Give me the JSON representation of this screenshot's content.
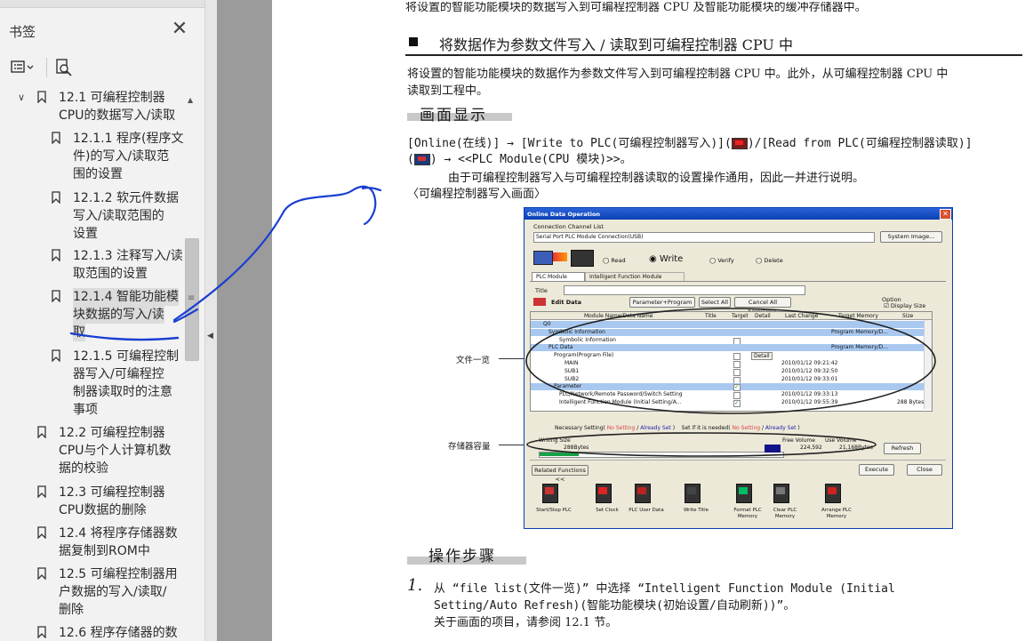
{
  "sidebar": {
    "title": "书签",
    "close_icon": "close-icon",
    "tools": {
      "options_icon": "list-options-icon",
      "search_icon": "bookmark-search-icon"
    },
    "items": [
      {
        "label_lines": [
          "12.1 可编程控制器",
          "CPU的数据写入/读取"
        ],
        "level": 1,
        "expanded": true
      },
      {
        "label_lines": [
          "12.1.1 程序(程序文",
          "件)的写入/读取范",
          "围的设置"
        ],
        "level": 2
      },
      {
        "label_lines": [
          "12.1.2 软元件数据",
          "写入/读取范围的",
          "设置"
        ],
        "level": 2
      },
      {
        "label_lines": [
          "12.1.3 注释写入/读",
          "取范围的设置"
        ],
        "level": 2
      },
      {
        "label_lines": [
          "12.1.4 智能功能模",
          "块数据的写入/读",
          "取"
        ],
        "level": 2,
        "selected": true
      },
      {
        "label_lines": [
          "12.1.5 可编程控制",
          "器写入/可编程控",
          "制器读取时的注意",
          "事项"
        ],
        "level": 2
      },
      {
        "label_lines": [
          "12.2 可编程控制器",
          "CPU与个人计算机数",
          "据的校验"
        ],
        "level": 1
      },
      {
        "label_lines": [
          "12.3 可编程控制器",
          "CPU数据的删除"
        ],
        "level": 1
      },
      {
        "label_lines": [
          "12.4 将程序存储器数",
          "据复制到ROM中"
        ],
        "level": 1
      },
      {
        "label_lines": [
          "12.5 可编程控制器用",
          "户数据的写入/读取/",
          "删除"
        ],
        "level": 1
      },
      {
        "label_lines": [
          "12.6 程序存储器的数"
        ],
        "level": 1
      }
    ]
  },
  "page": {
    "top_cut_line": "将设置的智能功能模块的数据写入到可编程控制器 CPU 及智能功能模块的缓冲存储器中。",
    "section_heading": "将数据作为参数文件写入 / 读取到可编程控制器 CPU 中",
    "para_line1": "将设置的智能功能模块的数据作为参数文件写入到可编程控制器 CPU 中。此外，从可编程控制器 CPU 中",
    "para_line2": "读取到工程中。",
    "screen_heading": "画面显示",
    "online_line1_a": "[Online(在线)] → [Write to PLC(可编程控制器写入)](",
    "online_line1_b": ")/[Read from PLC(可编程控制器读取)]",
    "online_line2_a": "(",
    "online_line2_b": ") → <<PLC Module(CPU 模块)>>。",
    "common_note": "由于可编程控制器写入与可编程控制器读取的设置操作通用，因此一并进行说明。",
    "write_screen_label": "〈可编程控制器写入画面〉",
    "label_file_list": "文件一览",
    "label_storage": "存储器容量",
    "steps_heading": "操作步骤",
    "step_num": "1.",
    "step_line1": "从 “file list(文件一览)” 中选择 “Intelligent Function Module (Initial",
    "step_line2": "Setting/Auto Refresh)(智能功能模块(初始设置/自动刷新))”。",
    "step_line3": "关于画面的项目，请参阅 12.1 节。"
  },
  "dialog": {
    "title": "Online Data Operation",
    "connection_label": "Connection Channel List",
    "connection_value": "Serial Port  PLC Module Connection(USB)",
    "system_image_btn": "System Image...",
    "modes": [
      "Read",
      "Write",
      "Verify",
      "Delete"
    ],
    "selected_mode": "Write",
    "tabs": [
      "PLC Module",
      "Intelligent Function Module"
    ],
    "title_label": "Title",
    "edit_data": "Edit Data",
    "btn_param_prog": "Parameter+Program",
    "btn_select_all": "Select All",
    "btn_cancel_all": "Cancel All Selections",
    "option_label": "Option",
    "display_size": "Display Size",
    "columns": [
      "Module Name/Data Name",
      "Title",
      "Target",
      "Detail",
      "Last Change",
      "Target Memory",
      "Size"
    ],
    "rows": [
      {
        "name": "Q0",
        "title": "",
        "change": "",
        "memory": "",
        "size": "",
        "band": true,
        "indent": 0,
        "checked": false
      },
      {
        "name": "Symbolic Information",
        "title": "",
        "change": "",
        "memory": "Program Memory/D...",
        "size": "",
        "band": true,
        "indent": 1,
        "checked": false
      },
      {
        "name": "Symbolic Information",
        "title": "",
        "change": "",
        "memory": "",
        "size": "",
        "band": false,
        "indent": 3,
        "checked": false
      },
      {
        "name": "PLC Data",
        "title": "",
        "change": "",
        "memory": "Program Memory/D...",
        "size": "",
        "band": true,
        "indent": 1,
        "checked": false
      },
      {
        "name": "Program(Program File)",
        "title": "",
        "change": "",
        "memory": "",
        "size": "",
        "band": false,
        "indent": 2,
        "checked": false,
        "detail": "Detail"
      },
      {
        "name": "MAIN",
        "title": "",
        "change": "2010/01/12 09:21:42",
        "memory": "",
        "size": "",
        "band": false,
        "indent": 4,
        "checked": false
      },
      {
        "name": "SUB1",
        "title": "",
        "change": "2010/01/12 09:32:50",
        "memory": "",
        "size": "",
        "band": false,
        "indent": 4,
        "checked": false
      },
      {
        "name": "SUB2",
        "title": "",
        "change": "2010/01/12 09:33:01",
        "memory": "",
        "size": "",
        "band": false,
        "indent": 4,
        "checked": false
      },
      {
        "name": "Parameter",
        "title": "",
        "change": "",
        "memory": "",
        "size": "",
        "band": true,
        "indent": 2,
        "checked": true
      },
      {
        "name": "PLC/Network/Remote Password/Switch Setting",
        "title": "",
        "change": "2010/01/12 09:33:13",
        "memory": "",
        "size": "",
        "band": false,
        "indent": 3,
        "checked": false
      },
      {
        "name": "Intelligent Function Module (Initial Setting/A...",
        "title": "",
        "change": "2010/01/12 09:55:39",
        "memory": "",
        "size": "288 Bytes",
        "band": false,
        "indent": 3,
        "checked": true
      }
    ],
    "necessary_setting": "Necessary Setting(",
    "no_setting": "No Setting",
    "already_set": "Already Set",
    "if_needed": "Set if it is needed(",
    "writing_size_label": "Writing Size",
    "writing_size": "288Bytes",
    "free_volume_label": "Free Volume",
    "free_volume": "224,592",
    "use_volume_label": "Use Volume",
    "use_volume": "21,168Bytes",
    "refresh_btn": "Refresh",
    "related_functions": "Related Functions <<",
    "execute_btn": "Execute",
    "close_btn": "Close",
    "functions": [
      "Start/Stop PLC",
      "Set Clock",
      "PLC User Data",
      "Write Title",
      "Format PLC Memory",
      "Clear PLC Memory",
      "Arrange PLC Memory"
    ]
  }
}
